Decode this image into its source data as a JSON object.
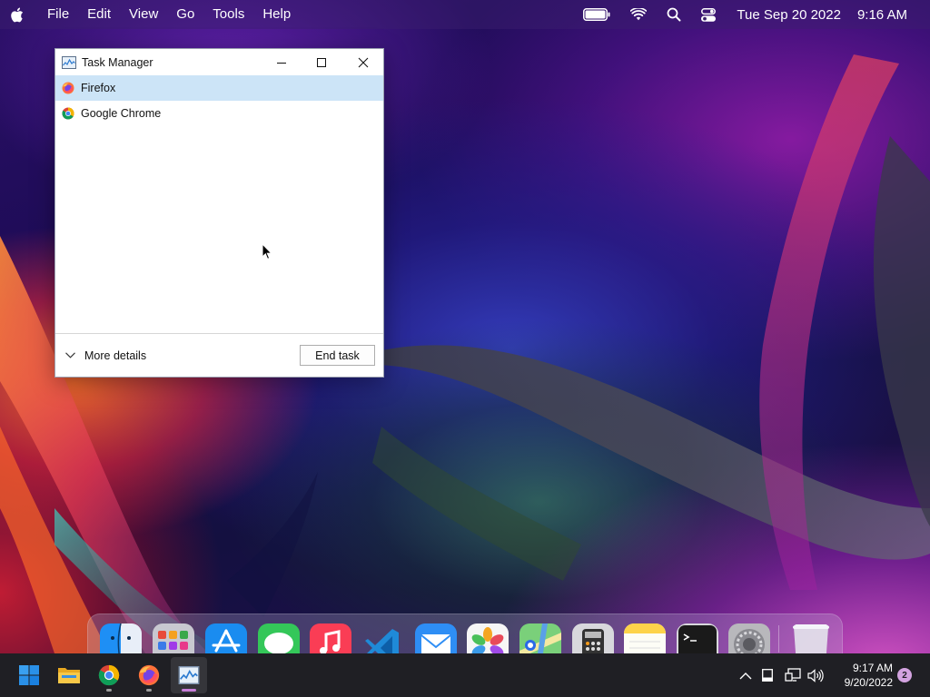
{
  "menubar": {
    "items": [
      "File",
      "Edit",
      "View",
      "Go",
      "Tools",
      "Help"
    ],
    "date": "Tue Sep 20 2022",
    "time": "9:16 AM",
    "icons": [
      "battery-icon",
      "wifi-icon",
      "search-icon",
      "control-center-icon"
    ]
  },
  "task_manager": {
    "title": "Task Manager",
    "processes": [
      {
        "name": "Firefox",
        "icon": "firefox-icon",
        "selected": true
      },
      {
        "name": "Google Chrome",
        "icon": "chrome-icon",
        "selected": false
      }
    ],
    "more_details": "More details",
    "end_task": "End task"
  },
  "dock": {
    "apps": [
      "finder",
      "launchpad",
      "app-store",
      "messages",
      "music",
      "vscode",
      "mail",
      "photos",
      "maps",
      "calculator",
      "notes",
      "terminal",
      "system-preferences",
      "trash"
    ]
  },
  "taskbar": {
    "apps": [
      "start",
      "file-explorer",
      "chrome",
      "firefox",
      "task-manager"
    ],
    "clock_time": "9:17 AM",
    "clock_date": "9/20/2022",
    "notification_count": "2"
  },
  "colors": {
    "selection": "#cce4f7",
    "taskbar_bg": "#1f1f24",
    "accent_indicator": "#c77dd8"
  }
}
